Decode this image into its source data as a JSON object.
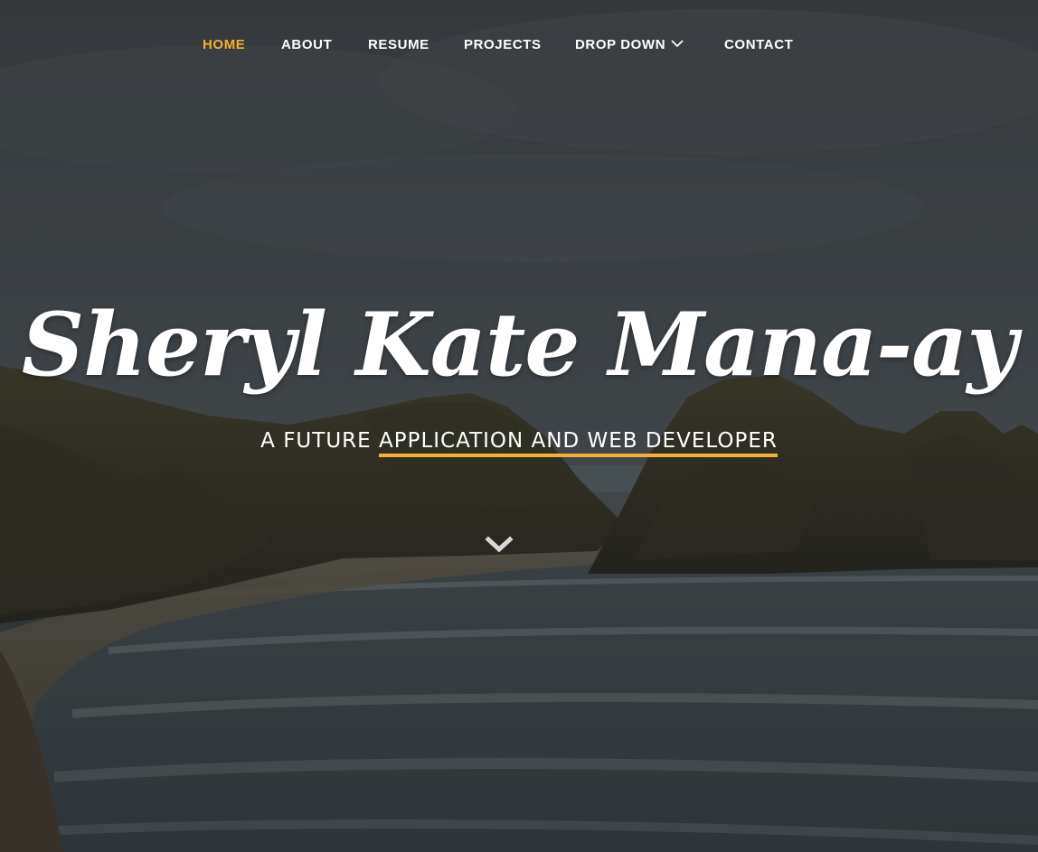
{
  "nav": {
    "items": [
      {
        "label": "HOME",
        "active": true
      },
      {
        "label": "ABOUT",
        "active": false
      },
      {
        "label": "RESUME",
        "active": false
      },
      {
        "label": "PROJECTS",
        "active": false
      },
      {
        "label": "DROP DOWN",
        "active": false,
        "icon": "chevron-down-icon"
      },
      {
        "label": "CONTACT",
        "active": false
      }
    ]
  },
  "hero": {
    "title": "Sheryl Kate Mana-ay",
    "subtitle_prefix": "A FUTURE",
    "subtitle_highlight": "APPLICATION AND WEB DEVELOPER",
    "scroll_icon": "chevron-down-icon"
  },
  "colors": {
    "accent": "#f2b230",
    "text": "#ffffff"
  }
}
